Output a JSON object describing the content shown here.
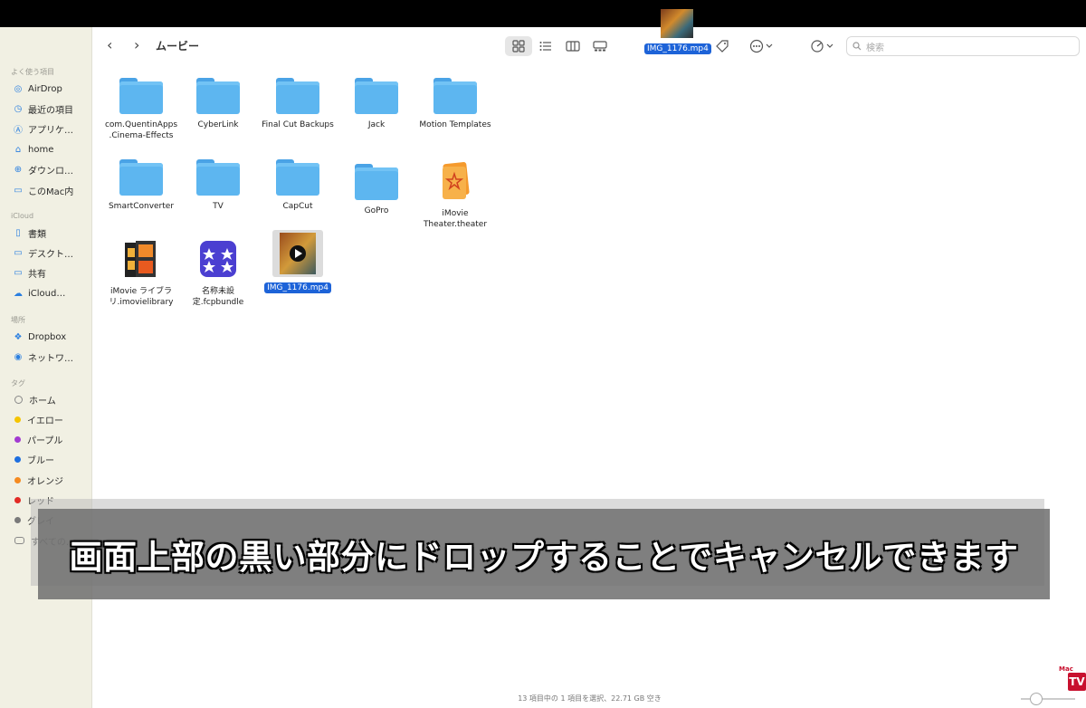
{
  "window": {
    "title": "ムービー"
  },
  "search": {
    "placeholder": "検索"
  },
  "drag": {
    "label": "IMG_1176.mp4"
  },
  "sidebar": {
    "favorites_header": "よく使う項目",
    "favorites": [
      {
        "label": "AirDrop",
        "icon": "airdrop-icon"
      },
      {
        "label": "最近の項目",
        "icon": "clock-icon"
      },
      {
        "label": "アプリケ…",
        "icon": "applications-icon"
      },
      {
        "label": "home",
        "icon": "house-icon"
      },
      {
        "label": "ダウンロ…",
        "icon": "download-icon"
      },
      {
        "label": "このMac内",
        "icon": "folder-icon"
      }
    ],
    "icloud_header": "iCloud",
    "icloud": [
      {
        "label": "書類",
        "icon": "document-icon"
      },
      {
        "label": "デスクト…",
        "icon": "desktop-icon"
      },
      {
        "label": "共有",
        "icon": "shared-folder-icon"
      },
      {
        "label": "iCloud…",
        "icon": "cloud-icon"
      }
    ],
    "places_header": "場所",
    "places": [
      {
        "label": "Dropbox",
        "icon": "dropbox-icon"
      },
      {
        "label": "ネットワ…",
        "icon": "network-icon"
      }
    ],
    "tags_header": "タグ",
    "tags": [
      {
        "label": "ホーム",
        "color": "#ffffff"
      },
      {
        "label": "イエロー",
        "color": "#f5c400"
      },
      {
        "label": "パープル",
        "color": "#a23ad1"
      },
      {
        "label": "ブルー",
        "color": "#1e6fe0"
      },
      {
        "label": "オレンジ",
        "color": "#f58a1f"
      },
      {
        "label": "レッド",
        "color": "#e22b25"
      },
      {
        "label": "グレイ",
        "color": "#7a7a7a"
      },
      {
        "label": "すべての…",
        "color": "none"
      }
    ]
  },
  "files": [
    {
      "label": "com.QuentinApps\n.Cinema-Effects",
      "kind": "folder"
    },
    {
      "label": "CyberLink",
      "kind": "folder"
    },
    {
      "label": "Final Cut Backups",
      "kind": "folder"
    },
    {
      "label": "Jack",
      "kind": "folder"
    },
    {
      "label": "Motion Templates",
      "kind": "folder"
    },
    {
      "label": "SmartConverter",
      "kind": "folder"
    },
    {
      "label": "TV",
      "kind": "folder"
    },
    {
      "label": "CapCut",
      "kind": "folder"
    },
    {
      "label": "GoPro",
      "kind": "folder"
    },
    {
      "label": "iMovie\nTheater.theater",
      "kind": "imovie-theater"
    },
    {
      "label": "iMovie ライブラ\nリ.imovielibrary",
      "kind": "imovie-library"
    },
    {
      "label": "名称未設\n定.fcpbundle",
      "kind": "fcpbundle"
    },
    {
      "label": "IMG_1176.mp4",
      "kind": "video",
      "selected": true
    }
  ],
  "status": {
    "text": "13 項目中の 1 項目を選択、22.71 GB 空き"
  },
  "caption": {
    "text": "画面上部の黒い部分にドロップすることでキャンセルできます"
  },
  "logo": {
    "top": "Mac",
    "tv": "TV"
  }
}
